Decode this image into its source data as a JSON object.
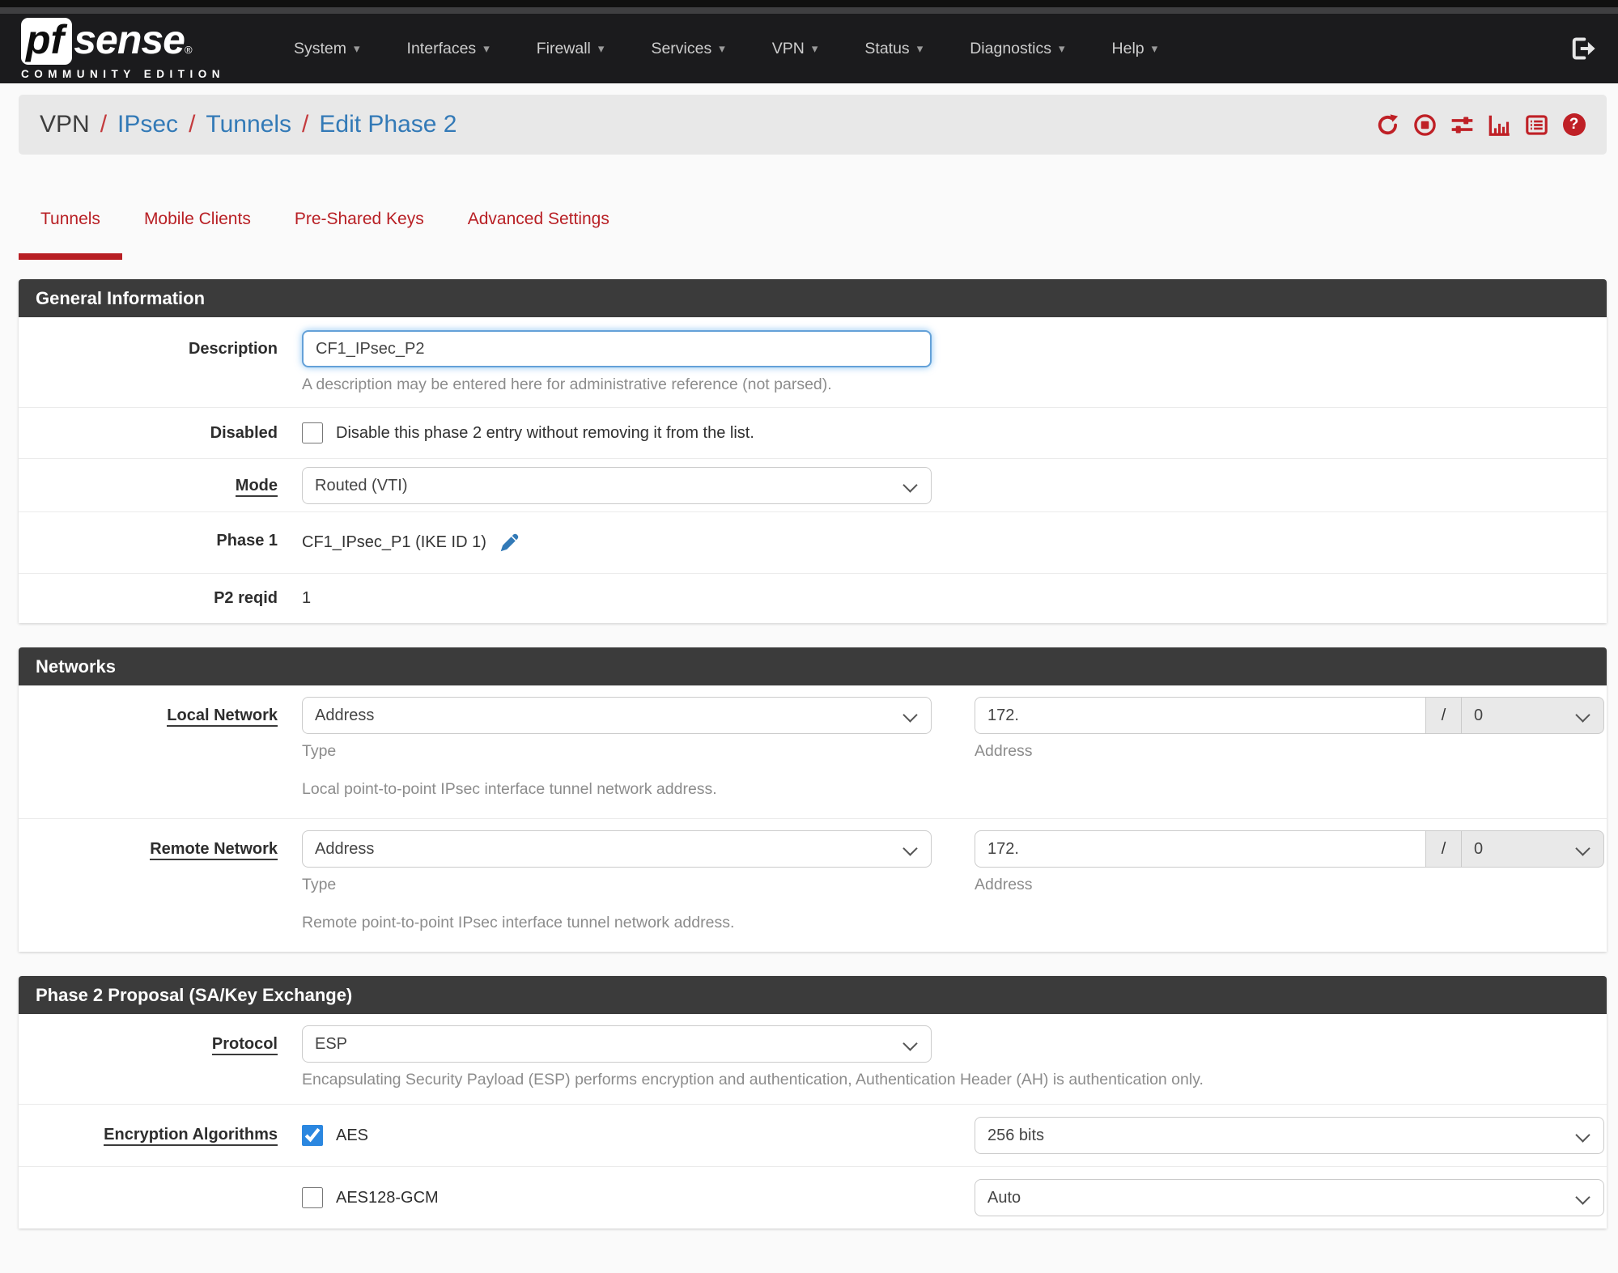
{
  "navbar": {
    "brand_pf": "pf",
    "brand_sense": "sense",
    "brand_reg": "®",
    "brand_edition": "COMMUNITY EDITION",
    "menus": [
      "System",
      "Interfaces",
      "Firewall",
      "Services",
      "VPN",
      "Status",
      "Diagnostics",
      "Help"
    ],
    "caret": "▾"
  },
  "breadcrumb": {
    "current": "VPN",
    "separator": "/",
    "links": [
      "IPsec",
      "Tunnels",
      "Edit Phase 2"
    ]
  },
  "header_icons": {
    "help_glyph": "?",
    "names": [
      "redo-icon",
      "stop-circle-icon",
      "sliders-icon",
      "bar-chart-icon",
      "log-icon",
      "help-icon"
    ]
  },
  "tabs": [
    "Tunnels",
    "Mobile Clients",
    "Pre-Shared Keys",
    "Advanced Settings"
  ],
  "active_tab": "Tunnels",
  "general": {
    "title": "General Information",
    "description": {
      "label": "Description",
      "value": "CF1_IPsec_P2",
      "help": "A description may be entered here for administrative reference (not parsed)."
    },
    "disabled": {
      "label": "Disabled",
      "checkbox_label": "Disable this phase 2 entry without removing it from the list.",
      "checked": false
    },
    "mode": {
      "label": "Mode",
      "value": "Routed (VTI)"
    },
    "phase1": {
      "label": "Phase 1",
      "value": "CF1_IPsec_P1 (IKE ID 1)"
    },
    "p2reqid": {
      "label": "P2 reqid",
      "value": "1"
    }
  },
  "networks": {
    "title": "Networks",
    "local": {
      "label": "Local Network",
      "type_value": "Address",
      "type_help": "Type",
      "address_value": "172.",
      "mask_separator": "/",
      "mask_value": "0",
      "address_help": "Address",
      "description": "Local point-to-point IPsec interface tunnel network address."
    },
    "remote": {
      "label": "Remote Network",
      "type_value": "Address",
      "type_help": "Type",
      "address_value": "172.",
      "mask_separator": "/",
      "mask_value": "0",
      "address_help": "Address",
      "description": "Remote point-to-point IPsec interface tunnel network address."
    }
  },
  "proposal": {
    "title": "Phase 2 Proposal (SA/Key Exchange)",
    "protocol": {
      "label": "Protocol",
      "value": "ESP",
      "help": "Encapsulating Security Payload (ESP) performs encryption and authentication, Authentication Header (AH) is authentication only."
    },
    "encryption": {
      "label": "Encryption Algorithms",
      "algorithms": [
        {
          "name": "AES",
          "checked": true,
          "bits": "256 bits"
        },
        {
          "name": "AES128-GCM",
          "checked": false,
          "bits": "Auto"
        }
      ]
    }
  },
  "colors": {
    "accent_red": "#b81f24",
    "icon_red": "#bf2026",
    "link_blue": "#337ab7",
    "panel_header": "#3b3b3b",
    "checkbox_blue": "#2b87e0"
  }
}
